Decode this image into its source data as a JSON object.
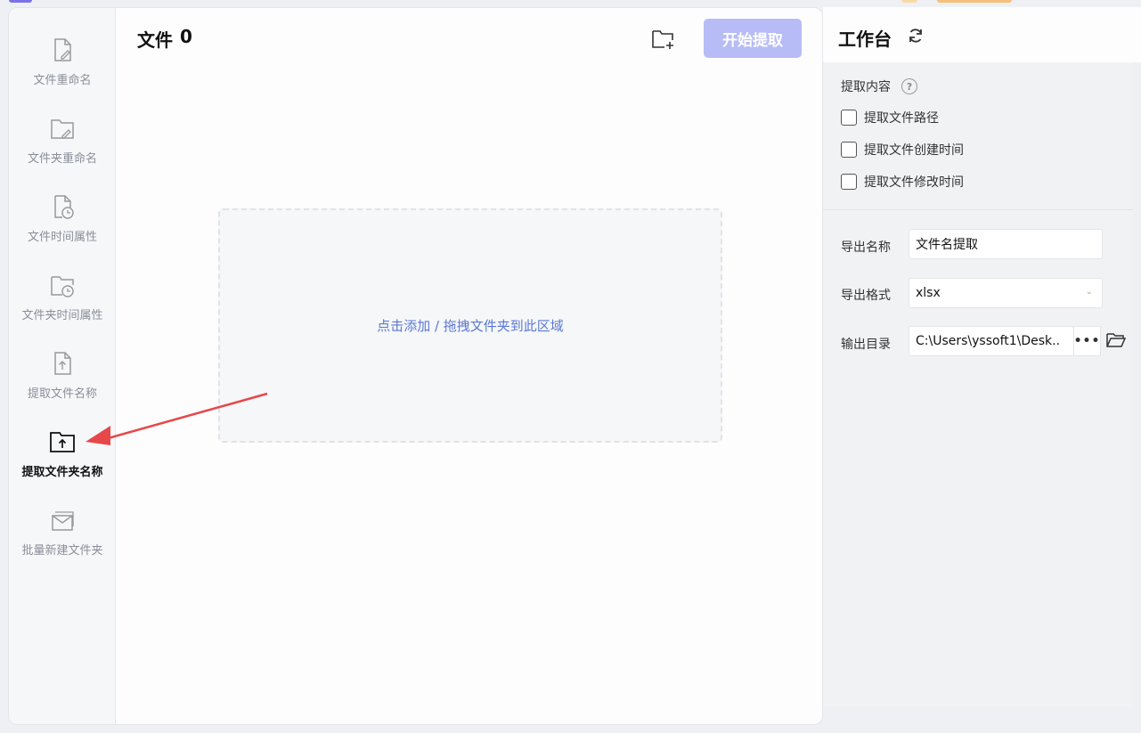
{
  "sidebar": {
    "items": [
      {
        "label": "文件重命名",
        "icon": "file-edit-icon"
      },
      {
        "label": "文件夹重命名",
        "icon": "folder-edit-icon"
      },
      {
        "label": "文件时间属性",
        "icon": "file-clock-icon"
      },
      {
        "label": "文件夹时间属性",
        "icon": "folder-clock-icon"
      },
      {
        "label": "提取文件名称",
        "icon": "file-upload-icon"
      },
      {
        "label": "提取文件夹名称",
        "icon": "folder-upload-icon",
        "active": true
      },
      {
        "label": "批量新建文件夹",
        "icon": "folder-batch-icon"
      }
    ]
  },
  "files": {
    "title": "文件",
    "count": "0",
    "start_button": "开始提取",
    "dropzone_text": "点击添加 / 拖拽文件夹到此区域"
  },
  "workbench": {
    "title": "工作台",
    "extract_content_label": "提取内容",
    "options": [
      {
        "label": "提取文件路径",
        "checked": false
      },
      {
        "label": "提取文件创建时间",
        "checked": false
      },
      {
        "label": "提取文件修改时间",
        "checked": false
      }
    ],
    "export_name_label": "导出名称",
    "export_name_value": "文件名提取",
    "export_format_label": "导出格式",
    "export_format_value": "xlsx",
    "output_dir_label": "输出目录",
    "output_dir_value": "C:\\Users\\yssoft1\\Desk..",
    "dots_label": "•••"
  },
  "colors": {
    "accent": "#5b78d4",
    "start_button_bg": "#b7bcf6",
    "arrow": "#e8474a"
  }
}
